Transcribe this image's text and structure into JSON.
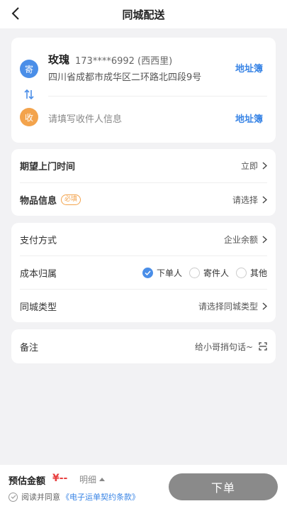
{
  "header": {
    "title": "同城配送"
  },
  "sender": {
    "badge": "寄",
    "name": "玫瑰",
    "phone": "173****6992 (西西里)",
    "address": "四川省成都市成华区二环路北四段9号",
    "addressbook_label": "地址簿"
  },
  "receiver": {
    "badge": "收",
    "placeholder": "请填写收件人信息",
    "addressbook_label": "地址簿"
  },
  "pickup": {
    "label": "期望上门时间",
    "value": "立即"
  },
  "goods": {
    "label": "物品信息",
    "tag": "必填",
    "value": "请选择"
  },
  "payment": {
    "label": "支付方式",
    "value": "企业余额"
  },
  "cost": {
    "label": "成本归属",
    "options": [
      "下单人",
      "寄件人",
      "其他"
    ],
    "selected": "下单人"
  },
  "city_type": {
    "label": "同城类型",
    "value": "请选择同城类型"
  },
  "note": {
    "label": "备注",
    "placeholder": "给小哥捎句话~"
  },
  "footer": {
    "estimate_label": "预估金额",
    "price": "¥--",
    "detail_label": "明细",
    "agree_text": "阅读并同意",
    "agree_link": "《电子运单契约条款》",
    "submit_label": "下单"
  },
  "colors": {
    "accent": "#3b86e6",
    "send_badge": "#4a8ee8",
    "recv_badge": "#f3a34c",
    "price": "#e84040"
  }
}
